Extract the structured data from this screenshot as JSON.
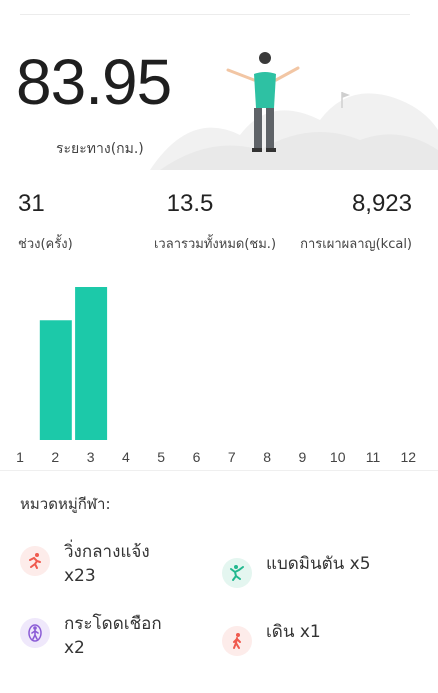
{
  "summary": {
    "distance_value": "83.95",
    "distance_label": "ระยะทาง(กม.)"
  },
  "stats": [
    {
      "value": "31",
      "label": "ช่วง(ครั้ง)"
    },
    {
      "value": "13.5",
      "label": "เวลารวมทั้งหมด(ชม.)"
    },
    {
      "value": "8,923",
      "label": "การเผาผลาญ(kcal)"
    }
  ],
  "chart_data": {
    "type": "bar",
    "categories": [
      "1",
      "2",
      "3",
      "4",
      "5",
      "6",
      "7",
      "8",
      "9",
      "10",
      "11",
      "12"
    ],
    "values": [
      0,
      18,
      23,
      0,
      0,
      0,
      0,
      0,
      0,
      0,
      0,
      0
    ],
    "color": "#1cc9a9"
  },
  "sports_title": "หมวดหมู่กีฬา:",
  "sports": [
    {
      "label": "วิ่งกลางแจ้ง x23",
      "icon": "running-icon",
      "color": "#ef5a4f",
      "bg": "#fdecea"
    },
    {
      "label": "แบดมินตัน x5",
      "icon": "badminton-icon",
      "color": "#22b88f",
      "bg": "#e4f6f0"
    },
    {
      "label": "กระโดดเชือก x2",
      "icon": "jump-rope-icon",
      "color": "#8b5cd6",
      "bg": "#efe8fb"
    },
    {
      "label": "เดิน x1",
      "icon": "walking-icon",
      "color": "#ef5a4f",
      "bg": "#fdecea"
    }
  ]
}
